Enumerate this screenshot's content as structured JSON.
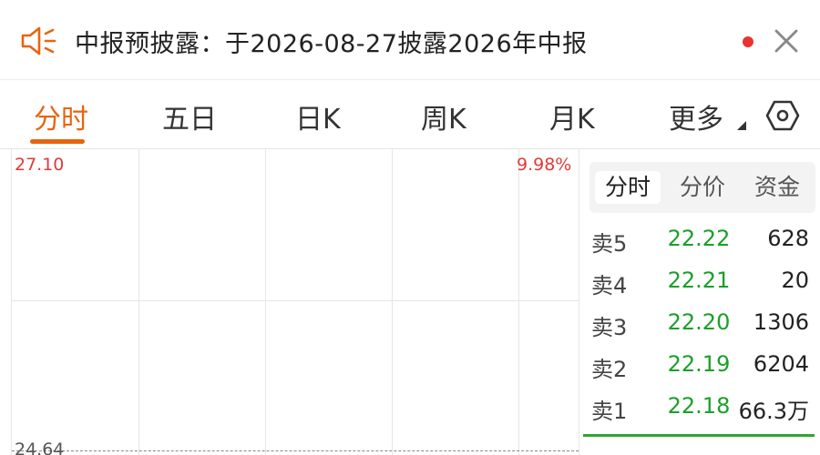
{
  "notice": {
    "text": "中报预披露：于2026-08-27披露2026年中报",
    "accent_color": "#e8640f",
    "dot_color": "#e8332f",
    "icons": [
      "speaker-icon",
      "close-icon"
    ]
  },
  "tabs": {
    "items": [
      {
        "label": "分时",
        "active": true
      },
      {
        "label": "五日",
        "active": false
      },
      {
        "label": "日K",
        "active": false
      },
      {
        "label": "周K",
        "active": false
      },
      {
        "label": "月K",
        "active": false
      },
      {
        "label": "更多",
        "active": false
      }
    ],
    "settings_icon": "hexagon-settings-icon"
  },
  "chart": {
    "price_high": "27.10",
    "pct_high": "9.98%",
    "price_base": "24.64",
    "up_color": "#e03a3a"
  },
  "orderbook": {
    "tabs": [
      {
        "label": "分时",
        "active": true
      },
      {
        "label": "分价",
        "active": false
      },
      {
        "label": "资金",
        "active": false
      }
    ],
    "asks": [
      {
        "label": "卖5",
        "price": "22.22",
        "volume": "628"
      },
      {
        "label": "卖4",
        "price": "22.21",
        "volume": "20"
      },
      {
        "label": "卖3",
        "price": "22.20",
        "volume": "1306"
      },
      {
        "label": "卖2",
        "price": "22.19",
        "volume": "6204"
      },
      {
        "label": "卖1",
        "price": "22.18",
        "volume": "66.3万"
      }
    ],
    "price_color": "#1aa02a"
  }
}
